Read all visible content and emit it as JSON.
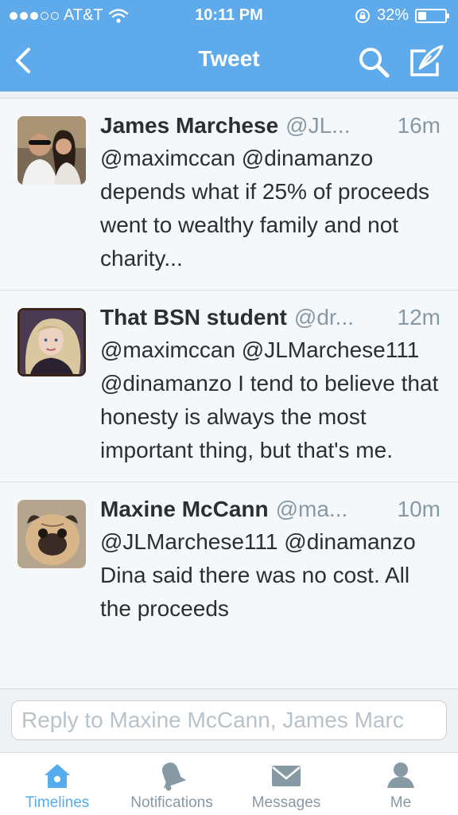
{
  "status_bar": {
    "carrier": "AT&T",
    "time": "10:11 PM",
    "battery": "32%",
    "battery_level": 0.32,
    "signal_bars_filled": 3,
    "signal_bars_total": 5
  },
  "nav": {
    "title": "Tweet",
    "back_icon": "chevron-left-icon",
    "search_icon": "search-icon",
    "compose_icon": "compose-icon"
  },
  "tweets": [
    {
      "name": "James Marchese",
      "handle": "@JL...",
      "time": "16m",
      "text": "@maximccan @dinamanzo depends what if 25% of proceeds went to wealthy family and not charity..."
    },
    {
      "name": "That BSN student",
      "handle": "@dr...",
      "time": "12m",
      "text": "@maximccan @JLMarchese111 @dinamanzo I tend to believe that honesty is always the most important thing, but that's me."
    },
    {
      "name": "Maxine McCann",
      "handle": "@ma...",
      "time": "10m",
      "text": "@JLMarchese111 @dinamanzo Dina said there was no cost. All the proceeds"
    }
  ],
  "reply": {
    "placeholder": "Reply to Maxine McCann, James Marc"
  },
  "tabs": [
    {
      "label": "Timelines",
      "icon": "home-icon",
      "active": true
    },
    {
      "label": "Notifications",
      "icon": "bell-icon",
      "active": false
    },
    {
      "label": "Messages",
      "icon": "envelope-icon",
      "active": false
    },
    {
      "label": "Me",
      "icon": "person-icon",
      "active": false
    }
  ],
  "colors": {
    "header": "#5eaaeb",
    "accent": "#55acee",
    "muted": "#8899a6",
    "text": "#292f33"
  }
}
